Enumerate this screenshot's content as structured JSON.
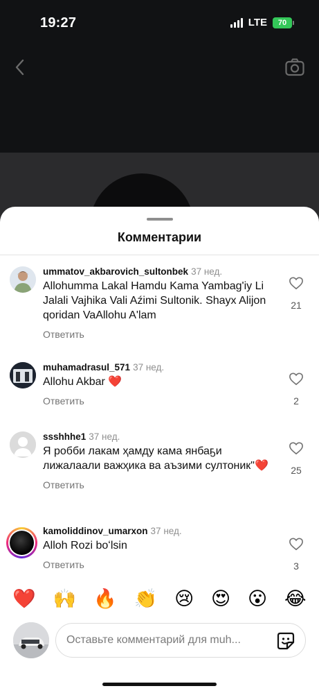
{
  "status_bar": {
    "time": "19:27",
    "network": "LTE",
    "battery": "70"
  },
  "sheet": {
    "title": "Комментарии"
  },
  "comments": [
    {
      "username": "ummatov_akbarovich_sultonbek",
      "time": "37 нед.",
      "text": "Allohumma Lakal Hamdu Kama Yambag'iy Li Jalali Vajhika Vali Aźimi Sultonik.  Shayx Alijon qoridan  VaAllohu A'lam",
      "reply": "Ответить",
      "likes": "21"
    },
    {
      "username": "muhamadrasul_571",
      "time": "37 нед.",
      "text": "Allohu Akbar ❤️",
      "reply": "Ответить",
      "likes": "2"
    },
    {
      "username": "ssshhhe1",
      "time": "37 нед.",
      "text": "Я робби лакам ҳамду кама янбаҕи лижалаали важҳика ва аъзими султоник\"❤️",
      "reply": "Ответить",
      "likes": "25"
    },
    {
      "username": "kamoliddinov_umarxon",
      "time": "37 нед.",
      "text": "Alloh Rozi boʻlsin",
      "reply": "Ответить",
      "likes": "3"
    }
  ],
  "emoji_bar": [
    "❤️",
    "🙌",
    "🔥",
    "👏",
    "😢",
    "😍",
    "😮",
    "😂"
  ],
  "composer": {
    "placeholder": "Оставьте комментарий для muh..."
  },
  "icons": {
    "back": "chevron-left-icon",
    "camera": "camera-icon",
    "heart": "heart-outline-icon",
    "sticker": "sticker-icon"
  },
  "colors": {
    "battery": "#34c759",
    "muted_text": "#737373",
    "heart_red": "#e0245e"
  }
}
